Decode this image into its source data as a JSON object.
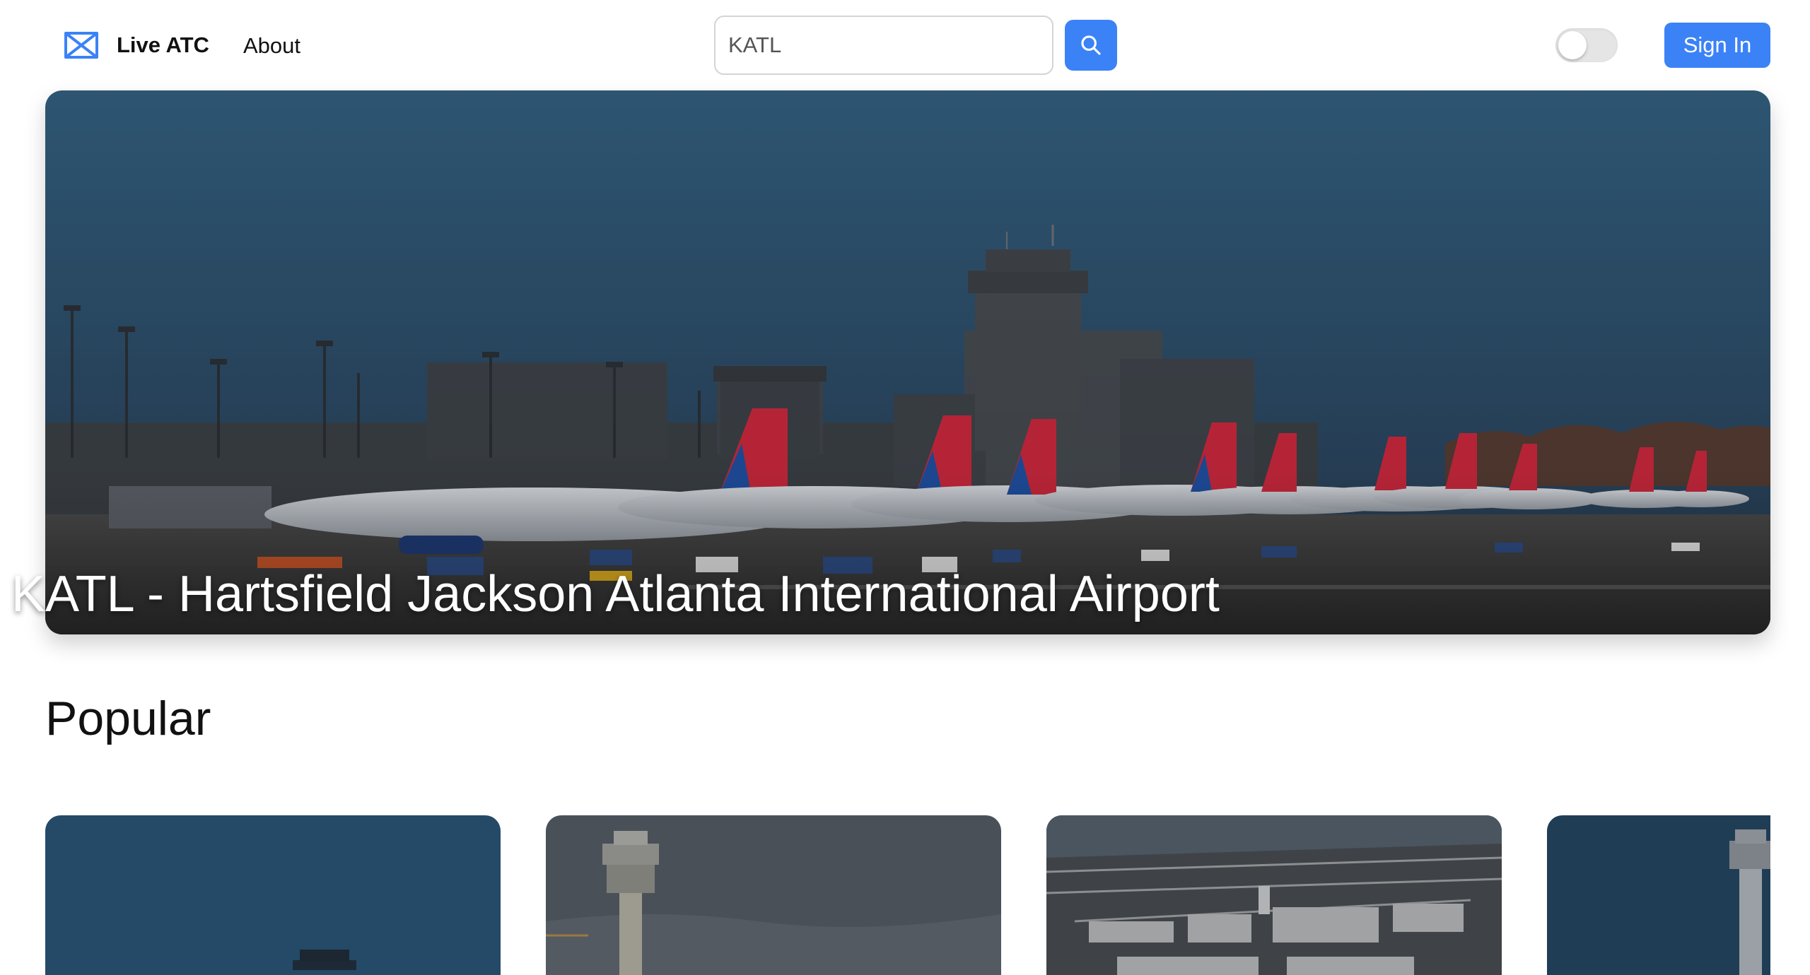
{
  "header": {
    "brand_name": "Live ATC",
    "brand_icon": "bowtie-logo-icon",
    "nav_about": "About",
    "search": {
      "value": "KATL",
      "placeholder": ""
    },
    "search_icon": "search-icon",
    "theme_toggle_on": false,
    "sign_in_label": "Sign In",
    "accent_color": "#3b82f6"
  },
  "hero": {
    "title": "KATL - Hartsfield Jackson Atlanta International Airport",
    "image": "airport-terminal-photo"
  },
  "popular": {
    "title": "Popular",
    "cards": [
      {
        "image": "control-tower-photo"
      },
      {
        "image": "control-tower-photo"
      },
      {
        "image": "airport-aerial-photo"
      },
      {
        "image": "control-tower-photo"
      }
    ]
  }
}
